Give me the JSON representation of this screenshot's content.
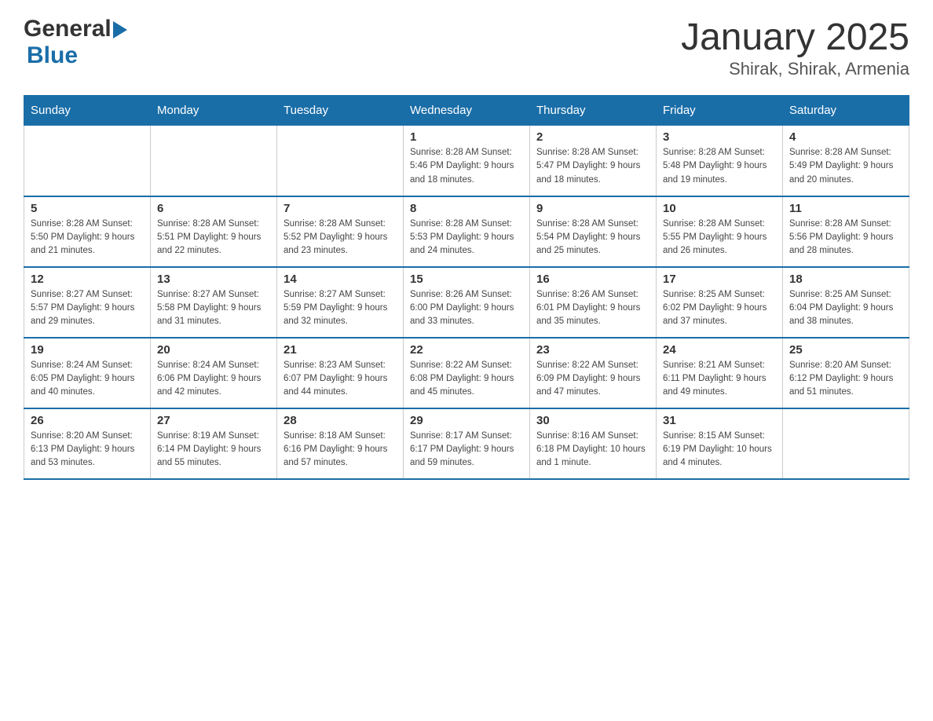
{
  "header": {
    "logo_general": "General",
    "logo_blue": "Blue",
    "title": "January 2025",
    "subtitle": "Shirak, Shirak, Armenia"
  },
  "calendar": {
    "days_of_week": [
      "Sunday",
      "Monday",
      "Tuesday",
      "Wednesday",
      "Thursday",
      "Friday",
      "Saturday"
    ],
    "weeks": [
      [
        {
          "day": "",
          "info": ""
        },
        {
          "day": "",
          "info": ""
        },
        {
          "day": "",
          "info": ""
        },
        {
          "day": "1",
          "info": "Sunrise: 8:28 AM\nSunset: 5:46 PM\nDaylight: 9 hours\nand 18 minutes."
        },
        {
          "day": "2",
          "info": "Sunrise: 8:28 AM\nSunset: 5:47 PM\nDaylight: 9 hours\nand 18 minutes."
        },
        {
          "day": "3",
          "info": "Sunrise: 8:28 AM\nSunset: 5:48 PM\nDaylight: 9 hours\nand 19 minutes."
        },
        {
          "day": "4",
          "info": "Sunrise: 8:28 AM\nSunset: 5:49 PM\nDaylight: 9 hours\nand 20 minutes."
        }
      ],
      [
        {
          "day": "5",
          "info": "Sunrise: 8:28 AM\nSunset: 5:50 PM\nDaylight: 9 hours\nand 21 minutes."
        },
        {
          "day": "6",
          "info": "Sunrise: 8:28 AM\nSunset: 5:51 PM\nDaylight: 9 hours\nand 22 minutes."
        },
        {
          "day": "7",
          "info": "Sunrise: 8:28 AM\nSunset: 5:52 PM\nDaylight: 9 hours\nand 23 minutes."
        },
        {
          "day": "8",
          "info": "Sunrise: 8:28 AM\nSunset: 5:53 PM\nDaylight: 9 hours\nand 24 minutes."
        },
        {
          "day": "9",
          "info": "Sunrise: 8:28 AM\nSunset: 5:54 PM\nDaylight: 9 hours\nand 25 minutes."
        },
        {
          "day": "10",
          "info": "Sunrise: 8:28 AM\nSunset: 5:55 PM\nDaylight: 9 hours\nand 26 minutes."
        },
        {
          "day": "11",
          "info": "Sunrise: 8:28 AM\nSunset: 5:56 PM\nDaylight: 9 hours\nand 28 minutes."
        }
      ],
      [
        {
          "day": "12",
          "info": "Sunrise: 8:27 AM\nSunset: 5:57 PM\nDaylight: 9 hours\nand 29 minutes."
        },
        {
          "day": "13",
          "info": "Sunrise: 8:27 AM\nSunset: 5:58 PM\nDaylight: 9 hours\nand 31 minutes."
        },
        {
          "day": "14",
          "info": "Sunrise: 8:27 AM\nSunset: 5:59 PM\nDaylight: 9 hours\nand 32 minutes."
        },
        {
          "day": "15",
          "info": "Sunrise: 8:26 AM\nSunset: 6:00 PM\nDaylight: 9 hours\nand 33 minutes."
        },
        {
          "day": "16",
          "info": "Sunrise: 8:26 AM\nSunset: 6:01 PM\nDaylight: 9 hours\nand 35 minutes."
        },
        {
          "day": "17",
          "info": "Sunrise: 8:25 AM\nSunset: 6:02 PM\nDaylight: 9 hours\nand 37 minutes."
        },
        {
          "day": "18",
          "info": "Sunrise: 8:25 AM\nSunset: 6:04 PM\nDaylight: 9 hours\nand 38 minutes."
        }
      ],
      [
        {
          "day": "19",
          "info": "Sunrise: 8:24 AM\nSunset: 6:05 PM\nDaylight: 9 hours\nand 40 minutes."
        },
        {
          "day": "20",
          "info": "Sunrise: 8:24 AM\nSunset: 6:06 PM\nDaylight: 9 hours\nand 42 minutes."
        },
        {
          "day": "21",
          "info": "Sunrise: 8:23 AM\nSunset: 6:07 PM\nDaylight: 9 hours\nand 44 minutes."
        },
        {
          "day": "22",
          "info": "Sunrise: 8:22 AM\nSunset: 6:08 PM\nDaylight: 9 hours\nand 45 minutes."
        },
        {
          "day": "23",
          "info": "Sunrise: 8:22 AM\nSunset: 6:09 PM\nDaylight: 9 hours\nand 47 minutes."
        },
        {
          "day": "24",
          "info": "Sunrise: 8:21 AM\nSunset: 6:11 PM\nDaylight: 9 hours\nand 49 minutes."
        },
        {
          "day": "25",
          "info": "Sunrise: 8:20 AM\nSunset: 6:12 PM\nDaylight: 9 hours\nand 51 minutes."
        }
      ],
      [
        {
          "day": "26",
          "info": "Sunrise: 8:20 AM\nSunset: 6:13 PM\nDaylight: 9 hours\nand 53 minutes."
        },
        {
          "day": "27",
          "info": "Sunrise: 8:19 AM\nSunset: 6:14 PM\nDaylight: 9 hours\nand 55 minutes."
        },
        {
          "day": "28",
          "info": "Sunrise: 8:18 AM\nSunset: 6:16 PM\nDaylight: 9 hours\nand 57 minutes."
        },
        {
          "day": "29",
          "info": "Sunrise: 8:17 AM\nSunset: 6:17 PM\nDaylight: 9 hours\nand 59 minutes."
        },
        {
          "day": "30",
          "info": "Sunrise: 8:16 AM\nSunset: 6:18 PM\nDaylight: 10 hours\nand 1 minute."
        },
        {
          "day": "31",
          "info": "Sunrise: 8:15 AM\nSunset: 6:19 PM\nDaylight: 10 hours\nand 4 minutes."
        },
        {
          "day": "",
          "info": ""
        }
      ]
    ]
  }
}
